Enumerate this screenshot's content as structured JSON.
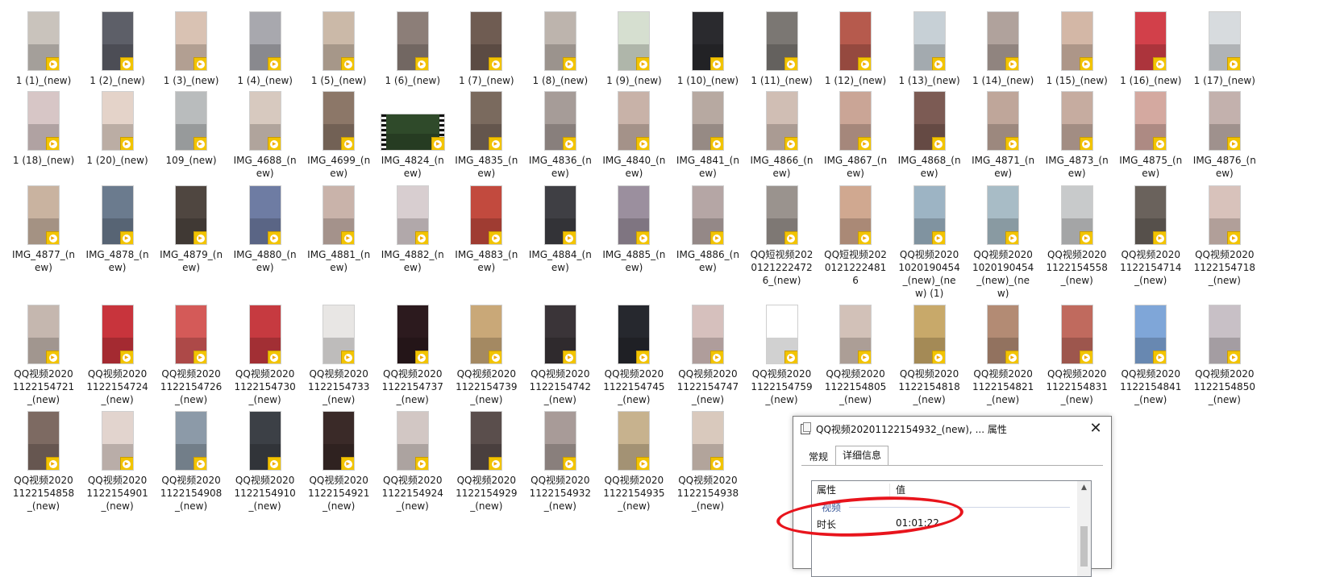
{
  "files": [
    {
      "label": "1 (1)_(new)",
      "tone": "#c9c3bc"
    },
    {
      "label": "1 (2)_(new)",
      "tone": "#5d5f68"
    },
    {
      "label": "1 (3)_(new)",
      "tone": "#d9c2b3"
    },
    {
      "label": "1 (4)_(new)",
      "tone": "#a8a8ae"
    },
    {
      "label": "1 (5)_(new)",
      "tone": "#cbb9a8"
    },
    {
      "label": "1 (6)_(new)",
      "tone": "#8c7e78"
    },
    {
      "label": "1 (7)_(new)",
      "tone": "#6f5c52"
    },
    {
      "label": "1 (8)_(new)",
      "tone": "#bdb4ad"
    },
    {
      "label": "1 (9)_(new)",
      "tone": "#d6dfd0"
    },
    {
      "label": "1 (10)_(new)",
      "tone": "#2a2a2e"
    },
    {
      "label": "1 (11)_(new)",
      "tone": "#7b7773"
    },
    {
      "label": "1 (12)_(new)",
      "tone": "#b65a4d"
    },
    {
      "label": "1 (13)_(new)",
      "tone": "#c7d0d6"
    },
    {
      "label": "1 (14)_(new)",
      "tone": "#b0a29c"
    },
    {
      "label": "1 (15)_(new)",
      "tone": "#d3b7a6"
    },
    {
      "label": "1 (16)_(new)",
      "tone": "#d2404a"
    },
    {
      "label": "1 (17)_(new)",
      "tone": "#d7dbde"
    },
    {
      "label": "1 (18)_(new)",
      "tone": "#d7c6c6"
    },
    {
      "label": "1 (20)_(new)",
      "tone": "#e4d3c9"
    },
    {
      "label": "109_(new)",
      "tone": "#b9bcbd"
    },
    {
      "label": "IMG_4688_(new)",
      "tone": "#d7c9bf"
    },
    {
      "label": "IMG_4699_(new)",
      "tone": "#8c7768"
    },
    {
      "label": "IMG_4824_(new)",
      "tone": "#2f4a2a",
      "wide": true
    },
    {
      "label": "IMG_4835_(new)",
      "tone": "#7a6a5e"
    },
    {
      "label": "IMG_4836_(new)",
      "tone": "#a69c98"
    },
    {
      "label": "IMG_4840_(new)",
      "tone": "#c8b2a8"
    },
    {
      "label": "IMG_4841_(new)",
      "tone": "#b7a9a1"
    },
    {
      "label": "IMG_4866_(new)",
      "tone": "#d0beb4"
    },
    {
      "label": "IMG_4867_(new)",
      "tone": "#caa596"
    },
    {
      "label": "IMG_4868_(new)",
      "tone": "#7c5b54"
    },
    {
      "label": "IMG_4871_(new)",
      "tone": "#bfa69a"
    },
    {
      "label": "IMG_4873_(new)",
      "tone": "#c6aca0"
    },
    {
      "label": "IMG_4875_(new)",
      "tone": "#d4a9a0"
    },
    {
      "label": "IMG_4876_(new)",
      "tone": "#c3b1ad"
    },
    {
      "label": "IMG_4877_(new)",
      "tone": "#c9b3a0"
    },
    {
      "label": "IMG_4878_(new)",
      "tone": "#6b7b8e"
    },
    {
      "label": "IMG_4879_(new)",
      "tone": "#4f4640"
    },
    {
      "label": "IMG_4880_(new)",
      "tone": "#6e7ca3"
    },
    {
      "label": "IMG_4881_(new)",
      "tone": "#c9b3aa"
    },
    {
      "label": "IMG_4882_(new)",
      "tone": "#d8ced0"
    },
    {
      "label": "IMG_4883_(new)",
      "tone": "#c24a3e"
    },
    {
      "label": "IMG_4884_(new)",
      "tone": "#3f3f44"
    },
    {
      "label": "IMG_4885_(new)",
      "tone": "#9b8f9e"
    },
    {
      "label": "IMG_4886_(new)",
      "tone": "#b5a6a5"
    },
    {
      "label": "QQ短视频20201212224726_(new)",
      "tone": "#9a938e"
    },
    {
      "label": "QQ短视频20201212224816",
      "tone": "#d0a890"
    },
    {
      "label": "QQ视频20201020190454_(new)_(new) (1)",
      "tone": "#9db4c4"
    },
    {
      "label": "QQ视频20201020190454_(new)_(new)",
      "tone": "#a8bcc6"
    },
    {
      "label": "QQ视频20201122154558_(new)",
      "tone": "#c8cacb"
    },
    {
      "label": "QQ视频20201122154714_(new)",
      "tone": "#6a625c"
    },
    {
      "label": "QQ视频20201122154718_(new)",
      "tone": "#d8c2bb"
    },
    {
      "label": "QQ视频20201122154721_(new)",
      "tone": "#c5b7af"
    },
    {
      "label": "QQ视频20201122154724_(new)",
      "tone": "#c8343c"
    },
    {
      "label": "QQ视频20201122154726_(new)",
      "tone": "#d45a58"
    },
    {
      "label": "QQ视频20201122154730_(new)",
      "tone": "#c63a40"
    },
    {
      "label": "QQ视频20201122154733_(new)",
      "tone": "#e8e6e4"
    },
    {
      "label": "QQ视频20201122154737_(new)",
      "tone": "#2c1a1e"
    },
    {
      "label": "QQ视频20201122154739_(new)",
      "tone": "#c9a878"
    },
    {
      "label": "QQ视频20201122154742_(new)",
      "tone": "#3a3438"
    },
    {
      "label": "QQ视频20201122154745_(new)",
      "tone": "#26282e"
    },
    {
      "label": "QQ视频20201122154747_(new)",
      "tone": "#d6c0bd"
    },
    {
      "label": "QQ视频20201122154759_(new)",
      "tone": "#ffffff"
    },
    {
      "label": "QQ视频20201122154805_(new)",
      "tone": "#d2c1b8"
    },
    {
      "label": "QQ视频20201122154818_(new)",
      "tone": "#c8a96a"
    },
    {
      "label": "QQ视频20201122154821_(new)",
      "tone": "#b38b74"
    },
    {
      "label": "QQ视频20201122154831_(new)",
      "tone": "#c06a5e"
    },
    {
      "label": "QQ视频20201122154841_(new)",
      "tone": "#7fa6d8"
    },
    {
      "label": "QQ视频20201122154850_(new)",
      "tone": "#c8c0c6"
    },
    {
      "label": "QQ视频20201122154858_(new)",
      "tone": "#7d6a62"
    },
    {
      "label": "QQ视频20201122154901_(new)",
      "tone": "#e2d4ce"
    },
    {
      "label": "QQ视频20201122154908_(new)",
      "tone": "#8c9aa8"
    },
    {
      "label": "QQ视频20201122154910_(new)",
      "tone": "#3c4046"
    },
    {
      "label": "QQ视频20201122154921_(new)",
      "tone": "#3a2a28"
    },
    {
      "label": "QQ视频20201122154924_(new)",
      "tone": "#d2c7c4"
    },
    {
      "label": "QQ视频20201122154929_(new)",
      "tone": "#5a4e4c"
    },
    {
      "label": "QQ视频20201122154932_(new)",
      "tone": "#a89b98"
    },
    {
      "label": "QQ视频20201122154935_(new)",
      "tone": "#c7b28e"
    },
    {
      "label": "QQ视频20201122154938_(new)",
      "tone": "#d9c9bd"
    }
  ],
  "badge": {
    "text": "▶",
    "tooltip": "Player",
    "color": "#f2c400"
  },
  "dialog": {
    "title": "QQ视频20201122154932_(new), ... 属性",
    "close_label": "✕",
    "tabs": [
      {
        "label": "常规"
      },
      {
        "label": "详细信息"
      }
    ],
    "columns": {
      "property": "属性",
      "value": "值"
    },
    "group": "视频",
    "rows": [
      {
        "name": "时长",
        "value": "01:01:22"
      }
    ],
    "scroll_up": "▲"
  },
  "highlight_color": "#e8141c"
}
